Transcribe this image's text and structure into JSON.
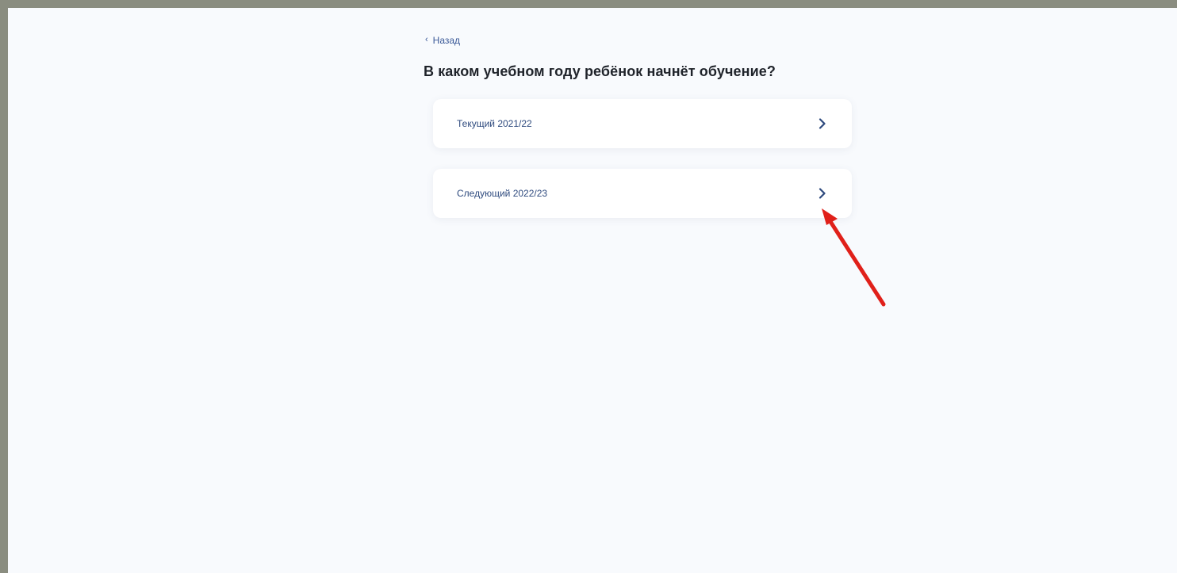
{
  "nav": {
    "back_label": "Назад"
  },
  "page": {
    "title": "В каком учебном году ребёнок начнёт обучение?"
  },
  "options": [
    {
      "label": "Текущий 2021/22",
      "icon": "chevron-right-icon"
    },
    {
      "label": "Следующий 2022/23",
      "icon": "chevron-right-icon"
    }
  ],
  "colors": {
    "background": "#f8fafd",
    "link": "#3b5998",
    "title": "#1f232a",
    "option_text": "#2e4a7e",
    "annotation_arrow": "#e0201a",
    "frame": "#8a8d80"
  }
}
